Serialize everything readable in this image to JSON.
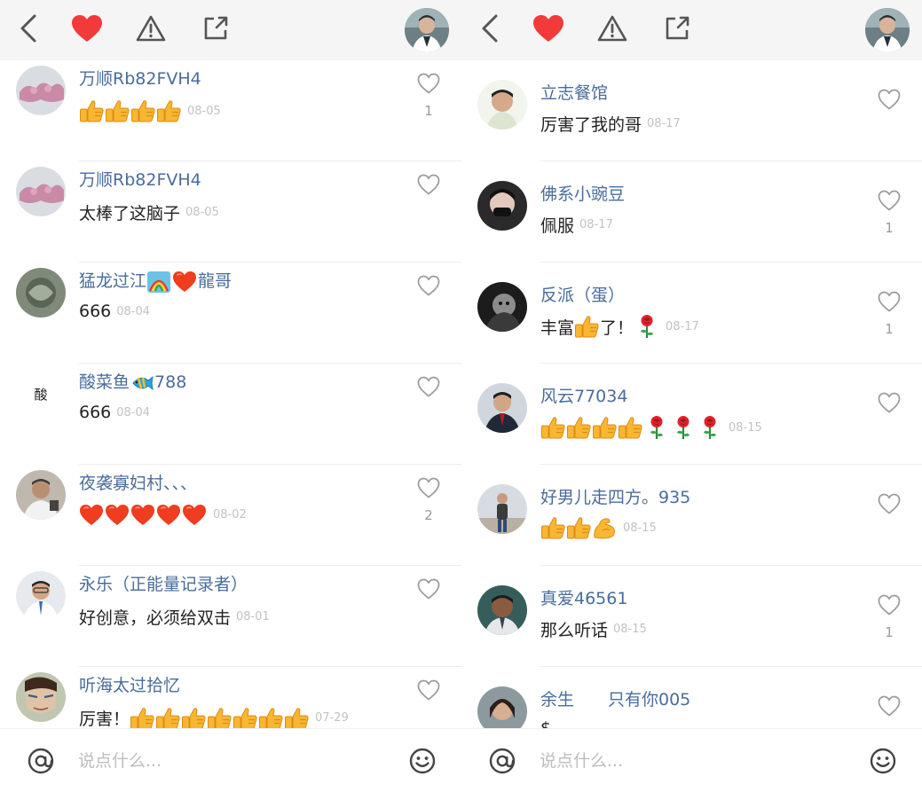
{
  "colors": {
    "name_link": "#4a6c9b",
    "heart_red": "#f23a3a",
    "date_gray": "#c2c2c2",
    "topbar_bg": "#f5f5f5"
  },
  "topbar": {
    "icons": [
      "back-icon",
      "heart-icon",
      "warning-icon",
      "share-icon"
    ],
    "avatar": "user-avatar"
  },
  "bottombar": {
    "placeholder": "说点什么...",
    "at_icon": "at-icon",
    "emoji_icon": "emoji-icon"
  },
  "left_comments": [
    {
      "name": "万顺Rb82FVH4",
      "text": "",
      "emojis": [
        "thumbs-up",
        "thumbs-up",
        "thumbs-up",
        "thumbs-up"
      ],
      "tail": [],
      "date": "08-05",
      "likes": "1"
    },
    {
      "name": "万顺Rb82FVH4",
      "text": "太棒了这脑子",
      "emojis": [],
      "tail": [],
      "date": "08-05",
      "likes": ""
    },
    {
      "name": "猛龙过江",
      "name_suffix": "龍哥",
      "name_emojis": [
        "rainbow",
        "red-heart"
      ],
      "text": "666",
      "emojis": [],
      "tail": [],
      "date": "08-04",
      "likes": ""
    },
    {
      "name": "酸菜鱼",
      "name_suffix": "788",
      "name_emojis": [
        "fish"
      ],
      "text": "666",
      "emojis": [],
      "tail": [],
      "date": "08-04",
      "likes": "",
      "text_avatar": "酸"
    },
    {
      "name": "夜袭寡妇村、、、",
      "text": "",
      "emojis": [
        "red-heart",
        "red-heart",
        "red-heart",
        "red-heart",
        "red-heart"
      ],
      "tail": [],
      "date": "08-02",
      "likes": "2"
    },
    {
      "name": "永乐（正能量记录者）",
      "text": "好创意，必须给双击",
      "emojis": [],
      "tail": [],
      "date": "08-01",
      "likes": ""
    },
    {
      "name": "听海太过拾忆",
      "text": "厉害！",
      "emojis": [
        "thumbs-up",
        "thumbs-up",
        "thumbs-up",
        "thumbs-up",
        "thumbs-up",
        "thumbs-up",
        "thumbs-up"
      ],
      "tail": [],
      "date": "07-29",
      "likes": ""
    }
  ],
  "right_comments": [
    {
      "name": "立志餐馆",
      "text": "厉害了我的哥",
      "emojis": [],
      "tail": [],
      "date": "08-17",
      "likes": ""
    },
    {
      "name": "佛系小豌豆",
      "text": "佩服",
      "emojis": [],
      "tail": [],
      "date": "08-17",
      "likes": "1"
    },
    {
      "name": "反派（蛋）",
      "text": "丰富",
      "emojis": [
        "thumbs-up"
      ],
      "text2": "了！",
      "tail": [
        "rose"
      ],
      "date": "08-17",
      "likes": "1"
    },
    {
      "name": "风云77034",
      "text": "",
      "emojis": [
        "thumbs-up",
        "thumbs-up",
        "thumbs-up",
        "thumbs-up"
      ],
      "tail": [
        "rose",
        "rose",
        "rose"
      ],
      "date": "08-15",
      "likes": ""
    },
    {
      "name": "好男儿走四方。935",
      "text": "",
      "emojis": [
        "thumbs-up",
        "thumbs-up",
        "flexed-arm"
      ],
      "tail": [],
      "date": "08-15",
      "likes": ""
    },
    {
      "name": "真爱46561",
      "text": "那么听话",
      "emojis": [],
      "tail": [],
      "date": "08-15",
      "likes": "1"
    },
    {
      "name": "余生　　只有你005",
      "text": "$",
      "emojis": [],
      "tail": [],
      "date": "",
      "likes": ""
    }
  ]
}
